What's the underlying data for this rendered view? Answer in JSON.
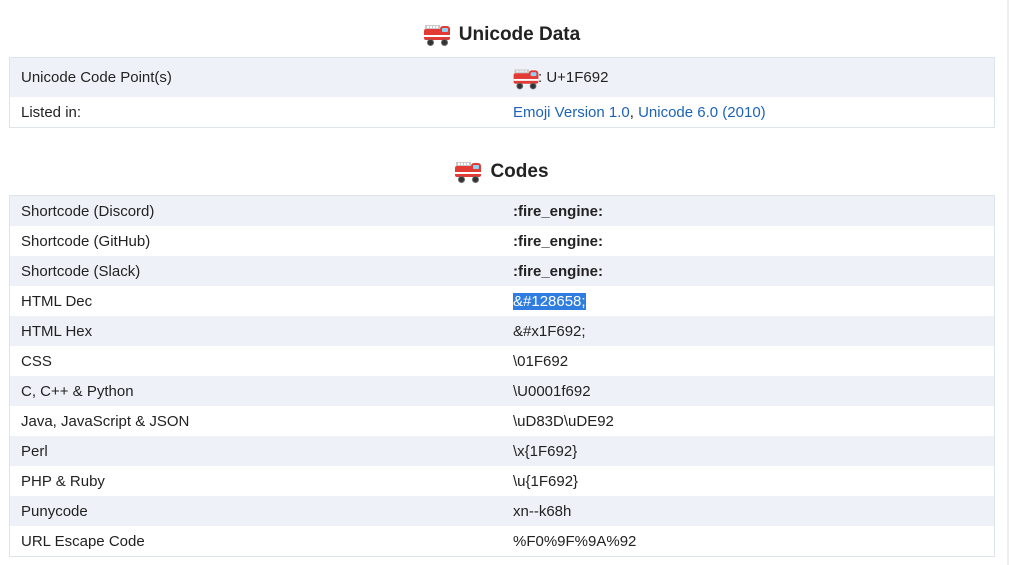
{
  "unicode_section": {
    "title": "Unicode Data",
    "rows": [
      {
        "label": "Unicode Code Point(s)",
        "value": ": U+1F692"
      },
      {
        "label": "Listed in:",
        "links": [
          "Emoji Version 1.0",
          "Unicode 6.0 (2010)"
        ],
        "separator": ", "
      }
    ]
  },
  "codes_section": {
    "title": "Codes",
    "rows": [
      {
        "label": "Shortcode (Discord)",
        "value": ":fire_engine:"
      },
      {
        "label": "Shortcode (GitHub)",
        "value": ":fire_engine:"
      },
      {
        "label": "Shortcode (Slack)",
        "value": ":fire_engine:"
      },
      {
        "label": "HTML Dec",
        "value": "&#128658;"
      },
      {
        "label": "HTML Hex",
        "value": "&#x1F692;"
      },
      {
        "label": "CSS",
        "value": "\\01F692"
      },
      {
        "label": "C, C++ & Python",
        "value": "\\U0001f692"
      },
      {
        "label": "Java, JavaScript & JSON",
        "value": "\\uD83D\\uDE92"
      },
      {
        "label": "Perl",
        "value": "\\x{1F692}"
      },
      {
        "label": "PHP & Ruby",
        "value": "\\u{1F692}"
      },
      {
        "label": "Punycode",
        "value": "xn--k68h"
      },
      {
        "label": "URL Escape Code",
        "value": "%F0%9F%9A%92"
      }
    ]
  },
  "icons": {
    "emoji": "fire-engine-icon"
  },
  "colors": {
    "row_alt": "#eef2f8",
    "link": "#1d63b5",
    "selection": "#2f7de1",
    "border": "#dfe3ea"
  }
}
